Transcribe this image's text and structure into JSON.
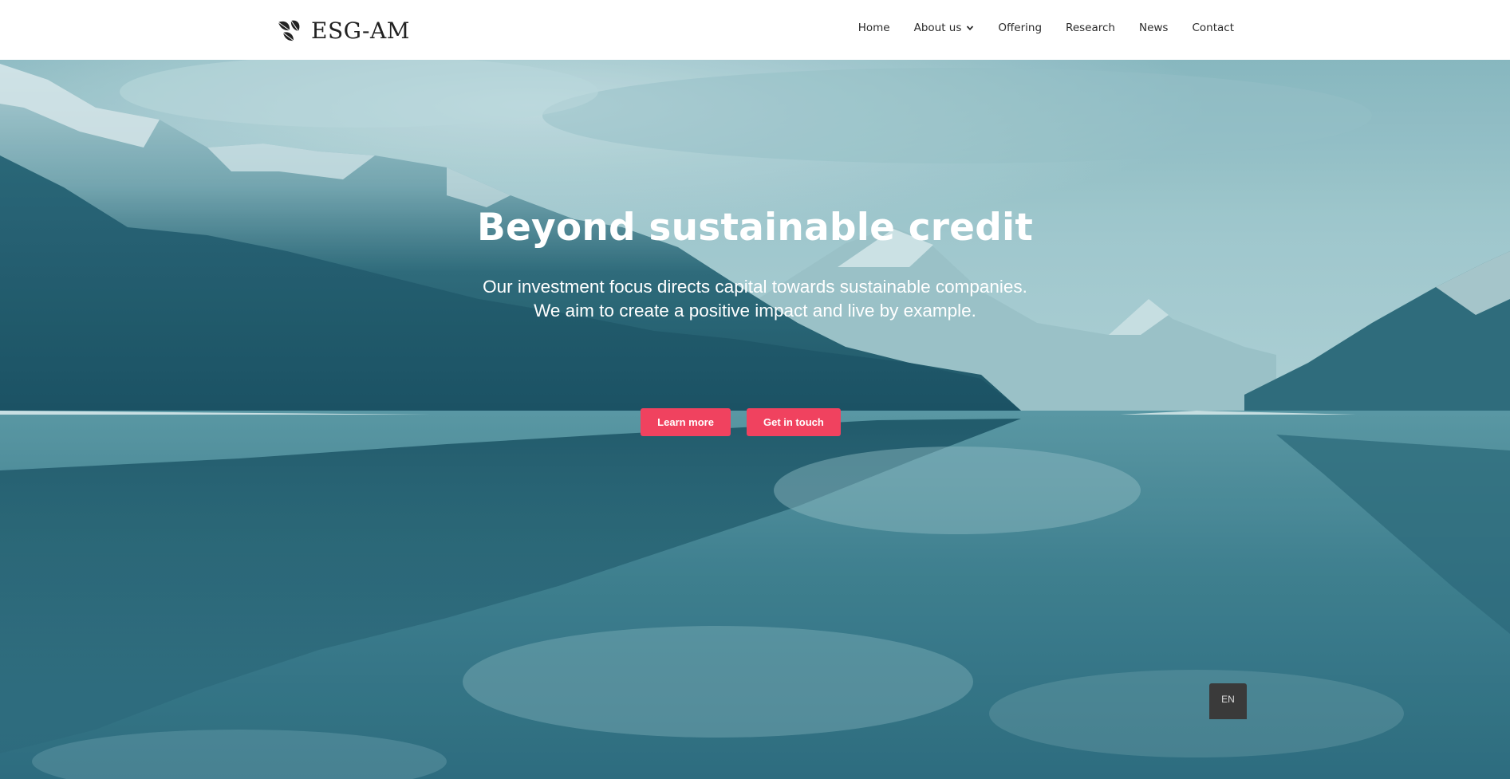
{
  "header": {
    "logo_text": "ESG-AM",
    "logo_icon": "leaf-mark-icon",
    "nav": [
      {
        "label": "Home"
      },
      {
        "label": "About us",
        "has_dropdown": true
      },
      {
        "label": "Offering"
      },
      {
        "label": "Research"
      },
      {
        "label": "News"
      },
      {
        "label": "Contact"
      }
    ]
  },
  "hero": {
    "title": "Beyond sustainable credit",
    "subtitle_line1": "Our investment focus directs capital towards sustainable companies.",
    "subtitle_line2": "We aim to create a positive impact and live by example.",
    "buttons": {
      "learn_more": "Learn more",
      "get_in_touch": "Get in touch"
    },
    "button_color": "#f0425f"
  },
  "language_switch": {
    "label": "EN"
  }
}
